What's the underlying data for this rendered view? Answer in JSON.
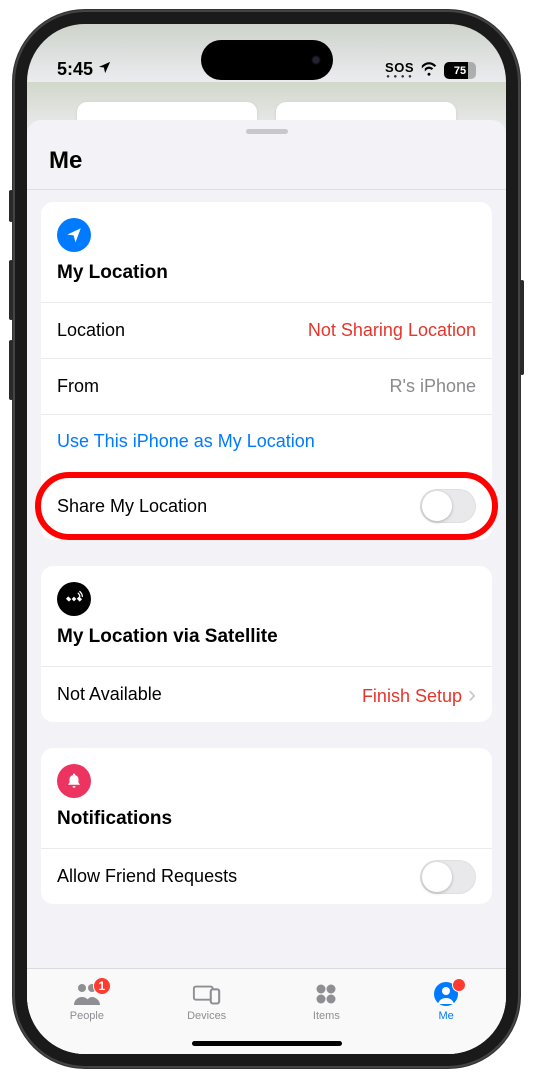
{
  "status": {
    "time": "5:45",
    "sos": "SOS",
    "battery": "75"
  },
  "sheet": {
    "title": "Me"
  },
  "location_card": {
    "heading": "My Location",
    "location_label": "Location",
    "location_value": "Not Sharing Location",
    "from_label": "From",
    "from_value": "R's iPhone",
    "use_iphone_link": "Use This iPhone as My Location",
    "share_label": "Share My Location"
  },
  "satellite_card": {
    "heading": "My Location via Satellite",
    "status_label": "Not Available",
    "action_label": "Finish Setup"
  },
  "notifications_card": {
    "heading": "Notifications",
    "allow_friend_label": "Allow Friend Requests"
  },
  "tabs": {
    "people": "People",
    "people_badge": "1",
    "devices": "Devices",
    "items": "Items",
    "me": "Me"
  }
}
